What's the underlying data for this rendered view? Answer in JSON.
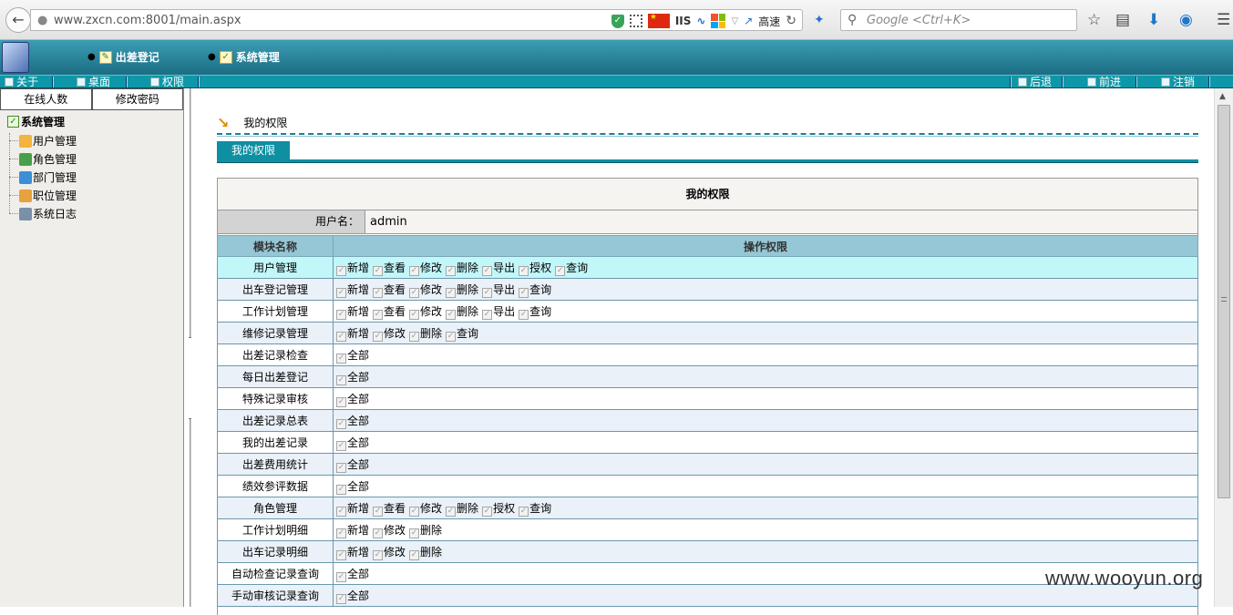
{
  "browser": {
    "url": "www.zxcn.com:8001/main.aspx",
    "iis_label": "IIS",
    "speed_label": "高速",
    "search_placeholder": "Google <Ctrl+K>"
  },
  "header": {
    "nav": [
      {
        "label": "出差登记"
      },
      {
        "label": "系统管理"
      }
    ]
  },
  "toolbar": {
    "left": [
      {
        "label": "关于"
      },
      {
        "label": "桌面"
      },
      {
        "label": "权限"
      }
    ],
    "right": [
      {
        "label": "后退"
      },
      {
        "label": "前进"
      },
      {
        "label": "注销"
      }
    ]
  },
  "sidebar": {
    "tabs": [
      {
        "label": "在线人数"
      },
      {
        "label": "修改密码"
      }
    ],
    "root": "系统管理",
    "items": [
      {
        "label": "用户管理"
      },
      {
        "label": "角色管理"
      },
      {
        "label": "部门管理"
      },
      {
        "label": "职位管理"
      },
      {
        "label": "系统日志"
      }
    ]
  },
  "main": {
    "breadcrumb": "我的权限",
    "section_tab": "我的权限",
    "table_title": "我的权限",
    "user_label": "用户名：",
    "user_value": "admin",
    "col_module": "模块名称",
    "col_ops": "操作权限",
    "rows": [
      {
        "module": "用户管理",
        "ops": [
          "新增",
          "查看",
          "修改",
          "删除",
          "导出",
          "授权",
          "查询"
        ]
      },
      {
        "module": "出车登记管理",
        "ops": [
          "新增",
          "查看",
          "修改",
          "删除",
          "导出",
          "查询"
        ]
      },
      {
        "module": "工作计划管理",
        "ops": [
          "新增",
          "查看",
          "修改",
          "删除",
          "导出",
          "查询"
        ]
      },
      {
        "module": "维修记录管理",
        "ops": [
          "新增",
          "修改",
          "删除",
          "查询"
        ]
      },
      {
        "module": "出差记录检查",
        "ops": [
          "全部"
        ]
      },
      {
        "module": "每日出差登记",
        "ops": [
          "全部"
        ]
      },
      {
        "module": "特殊记录审核",
        "ops": [
          "全部"
        ]
      },
      {
        "module": "出差记录总表",
        "ops": [
          "全部"
        ]
      },
      {
        "module": "我的出差记录",
        "ops": [
          "全部"
        ]
      },
      {
        "module": "出差费用统计",
        "ops": [
          "全部"
        ]
      },
      {
        "module": "绩效参评数据",
        "ops": [
          "全部"
        ]
      },
      {
        "module": "角色管理",
        "ops": [
          "新增",
          "查看",
          "修改",
          "删除",
          "授权",
          "查询"
        ]
      },
      {
        "module": "工作计划明细",
        "ops": [
          "新增",
          "修改",
          "删除"
        ]
      },
      {
        "module": "出车记录明细",
        "ops": [
          "新增",
          "修改",
          "删除"
        ]
      },
      {
        "module": "自动检查记录查询",
        "ops": [
          "全部"
        ]
      },
      {
        "module": "手动审核记录查询",
        "ops": [
          "全部"
        ]
      }
    ]
  },
  "watermark": "www.wooyun.org",
  "colors": {
    "header_teal": "#1b6d83",
    "toolbar_teal": "#0d97a8",
    "table_header": "#95c7d6",
    "row_highlight": "#c2f7fa"
  }
}
